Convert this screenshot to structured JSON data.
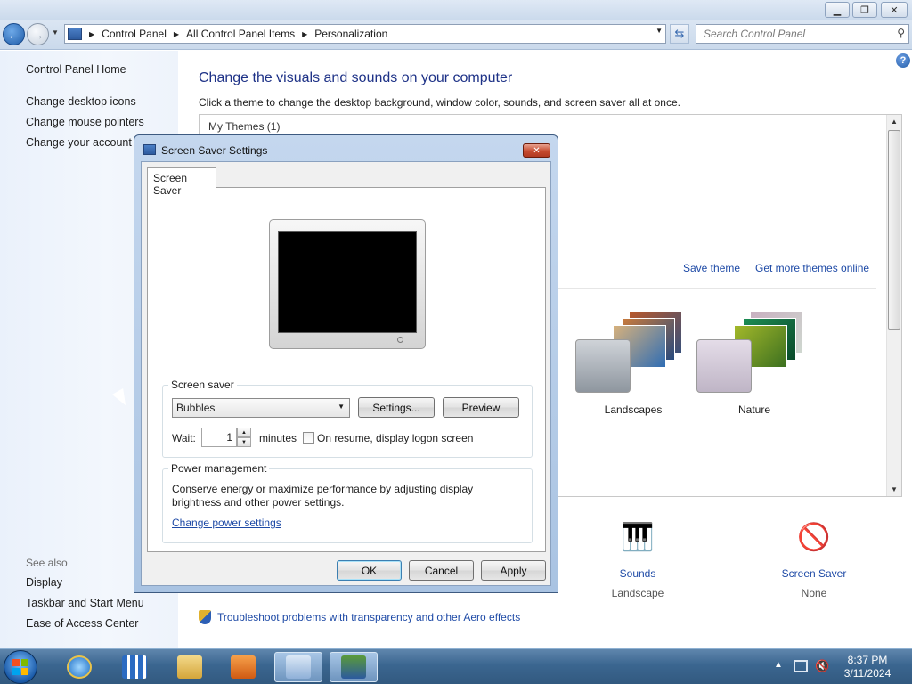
{
  "window": {
    "breadcrumbs": [
      "Control Panel",
      "All Control Panel Items",
      "Personalization"
    ],
    "search_placeholder": "Search Control Panel"
  },
  "left_pane": {
    "home": "Control Panel Home",
    "links": [
      "Change desktop icons",
      "Change mouse pointers",
      "Change your account p"
    ],
    "see_also_title": "See also",
    "see_also": [
      "Display",
      "Taskbar and Start Menu",
      "Ease of Access Center"
    ]
  },
  "main": {
    "title": "Change the visuals and sounds on your computer",
    "description": "Click a theme to change the desktop background, window color, sounds, and screen saver all at once.",
    "my_themes": "My Themes (1)",
    "save_theme": "Save theme",
    "more_themes": "Get more themes online",
    "themes": [
      {
        "name": "Landscapes"
      },
      {
        "name": "Nature"
      }
    ],
    "bottom": {
      "sounds_label": "Sounds",
      "sounds_value": "Landscape",
      "screensaver_label": "Screen Saver",
      "screensaver_value": "None"
    },
    "aero_link": "Troubleshoot problems with transparency and other Aero effects"
  },
  "dialog": {
    "title": "Screen Saver Settings",
    "tab": "Screen Saver",
    "screen_saver_group": "Screen saver",
    "selected_saver": "Bubbles",
    "settings_button": "Settings...",
    "preview_button": "Preview",
    "wait_label": "Wait:",
    "wait_value": "1",
    "minutes_label": "minutes",
    "resume_label": "On resume, display logon screen",
    "resume_checked": false,
    "power_group": "Power management",
    "power_text": "Conserve energy or maximize performance by adjusting display brightness and other power settings.",
    "power_link": "Change power settings",
    "ok": "OK",
    "cancel": "Cancel",
    "apply": "Apply"
  },
  "taskbar": {
    "time": "8:37 PM",
    "date": "3/11/2024",
    "icons": [
      "ie-icon",
      "apps-icon",
      "explorer-icon",
      "media-player-icon",
      "control-panel-icon",
      "screensaver-icon"
    ]
  }
}
